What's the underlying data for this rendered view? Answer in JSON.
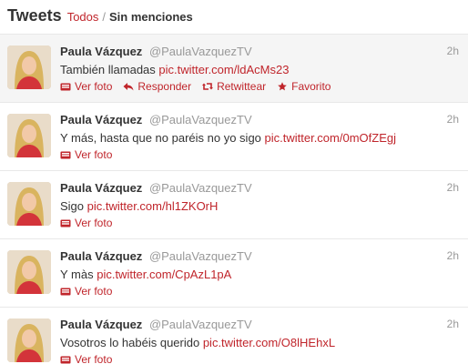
{
  "header": {
    "title": "Tweets",
    "filter_all": "Todos",
    "separator": "/",
    "filter_current": "Sin menciones"
  },
  "colors": {
    "link": "#c0252b",
    "muted": "#999999",
    "text": "#333333"
  },
  "tweets": [
    {
      "name": "Paula Vázquez",
      "handle": "@PaulaVazquezTV",
      "time": "2h",
      "text": "También llamadas ",
      "link": "pic.twitter.com/ldAcMs23",
      "action_view": "Ver foto",
      "action_reply": "Responder",
      "action_retweet": "Retwittear",
      "action_favorite": "Favorito"
    },
    {
      "name": "Paula Vázquez",
      "handle": "@PaulaVazquezTV",
      "time": "2h",
      "text": "Y más, hasta que no paréis no yo sigo ",
      "link": "pic.twitter.com/0mOfZEgj",
      "action_view": "Ver foto"
    },
    {
      "name": "Paula Vázquez",
      "handle": "@PaulaVazquezTV",
      "time": "2h",
      "text": "Sigo ",
      "link": "pic.twitter.com/hl1ZKOrH",
      "action_view": "Ver foto"
    },
    {
      "name": "Paula Vázquez",
      "handle": "@PaulaVazquezTV",
      "time": "2h",
      "text": "Y màs ",
      "link": "pic.twitter.com/CpAzL1pA",
      "action_view": "Ver foto"
    },
    {
      "name": "Paula Vázquez",
      "handle": "@PaulaVazquezTV",
      "time": "2h",
      "text": "Vosotros lo habéis querido ",
      "link": "pic.twitter.com/O8lHEhxL",
      "action_view": "Ver foto"
    }
  ]
}
